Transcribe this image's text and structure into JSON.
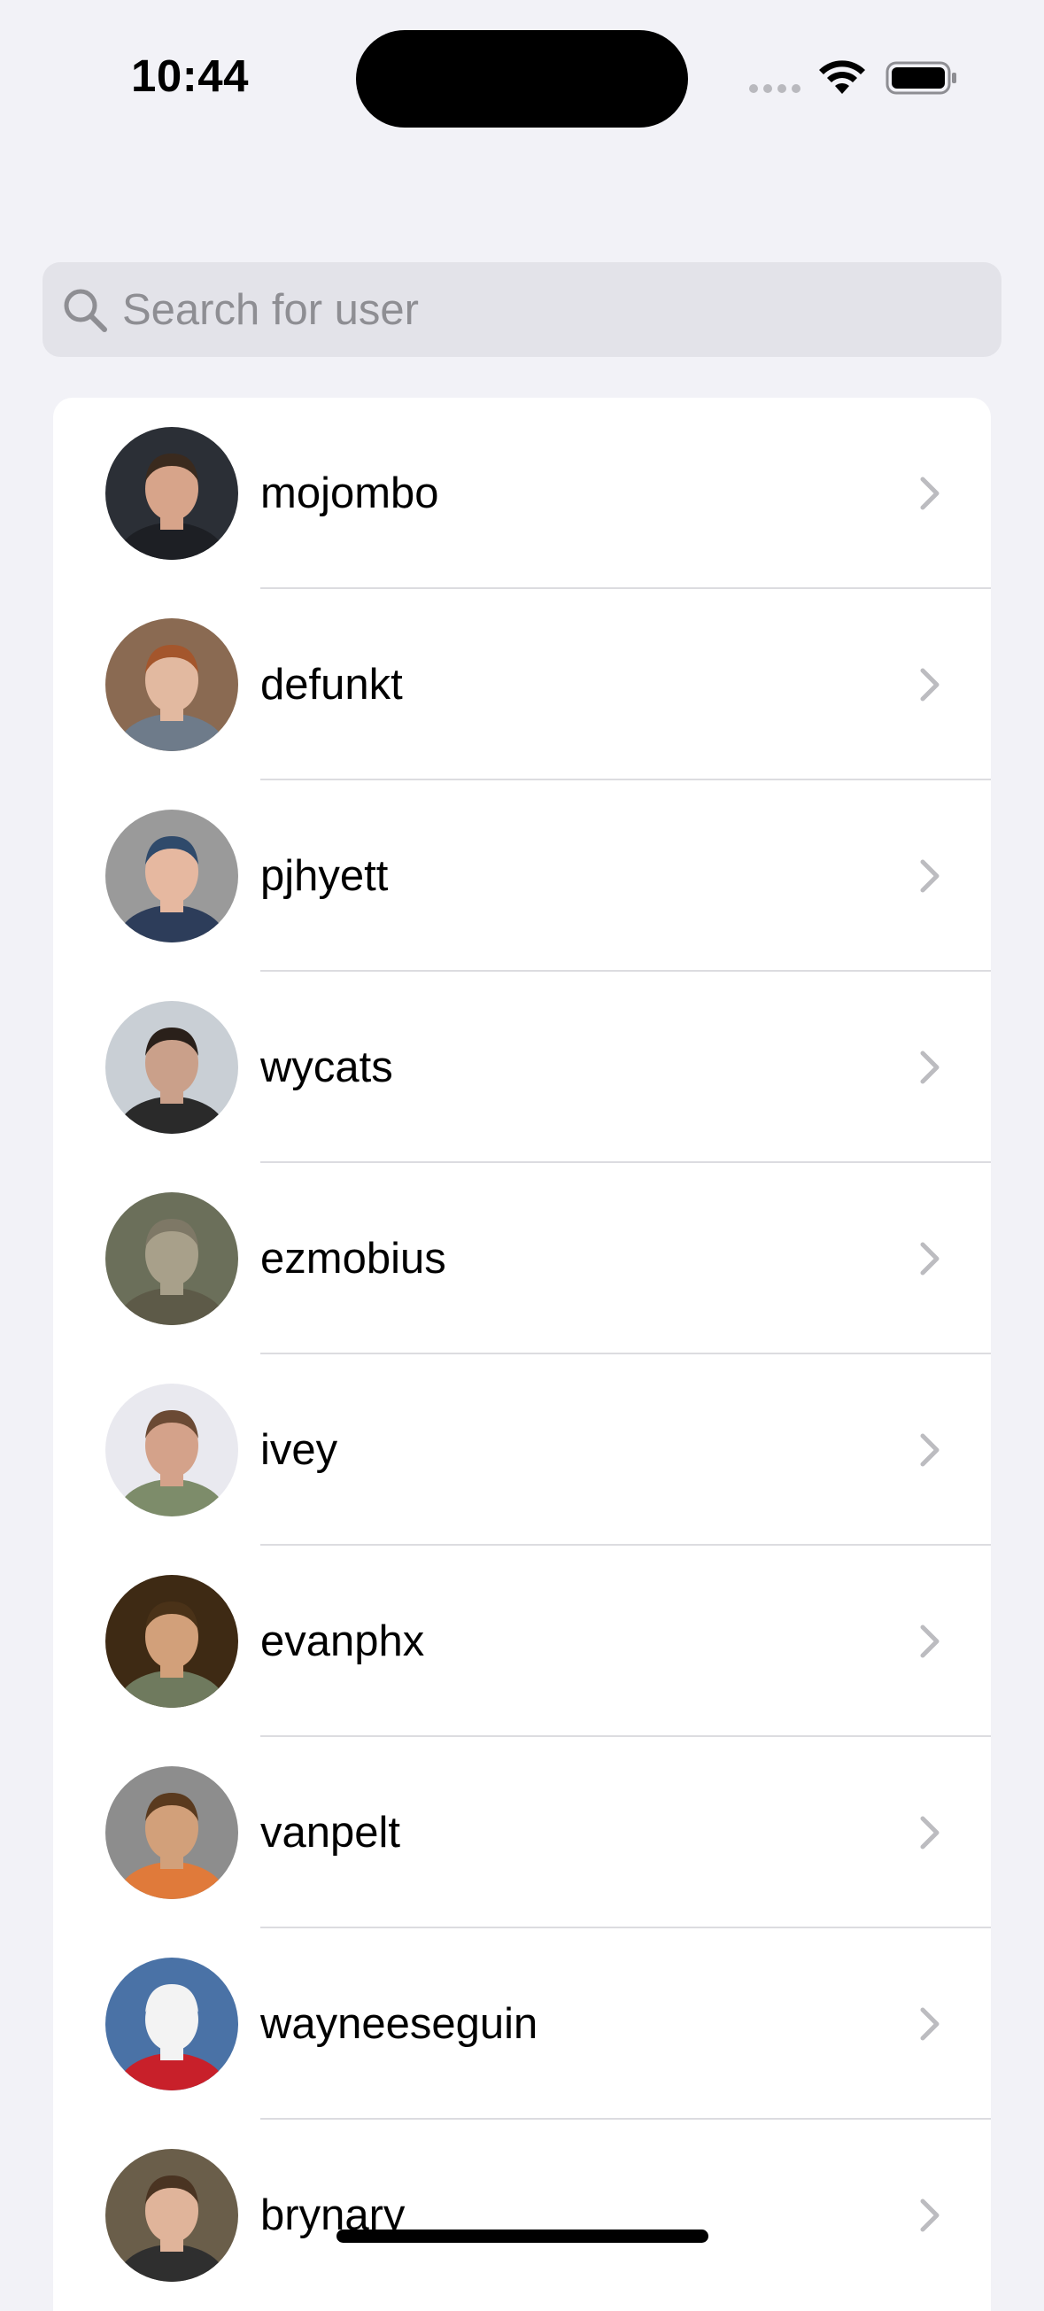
{
  "status_bar": {
    "time": "10:44"
  },
  "search": {
    "placeholder": "Search for user",
    "value": ""
  },
  "users": [
    {
      "login": "mojombo",
      "avatar": {
        "bg": "#2b2f36",
        "skin": "#d7a48a",
        "hair": "#3a2a1e",
        "shirt": "#1d1f24"
      }
    },
    {
      "login": "defunkt",
      "avatar": {
        "bg": "#8a6a52",
        "skin": "#e2b9a0",
        "hair": "#a4562c",
        "shirt": "#6e7b8a"
      }
    },
    {
      "login": "pjhyett",
      "avatar": {
        "bg": "#9a9a9a",
        "skin": "#e6b8a0",
        "hair": "#2f4a6b",
        "shirt": "#2d3d5a"
      }
    },
    {
      "login": "wycats",
      "avatar": {
        "bg": "#c9cfd5",
        "skin": "#caa08a",
        "hair": "#2a201a",
        "shirt": "#2a2a2a"
      }
    },
    {
      "login": "ezmobius",
      "avatar": {
        "bg": "#6b6f5a",
        "skin": "#a8a08a",
        "hair": "#7e7866",
        "shirt": "#5d5a48"
      }
    },
    {
      "login": "ivey",
      "avatar": {
        "bg": "#e9e9ef",
        "skin": "#d4a28a",
        "hair": "#6b4a34",
        "shirt": "#7d8c6a"
      }
    },
    {
      "login": "evanphx",
      "avatar": {
        "bg": "#3e2a14",
        "skin": "#d2a07a",
        "hair": "#4a3218",
        "shirt": "#6f7a5e"
      }
    },
    {
      "login": "vanpelt",
      "avatar": {
        "bg": "#8d8d8d",
        "skin": "#d2a07a",
        "hair": "#5a3a1e",
        "shirt": "#e07a3a"
      }
    },
    {
      "login": "wayneeseguin",
      "avatar": {
        "bg": "#4a72a6",
        "skin": "#f3f3f3",
        "hair": "#f3f3f3",
        "shirt": "#c8202a"
      }
    },
    {
      "login": "brynary",
      "avatar": {
        "bg": "#6a5e4a",
        "skin": "#e0b49a",
        "hair": "#4a3422",
        "shirt": "#2f2f2f"
      }
    }
  ]
}
